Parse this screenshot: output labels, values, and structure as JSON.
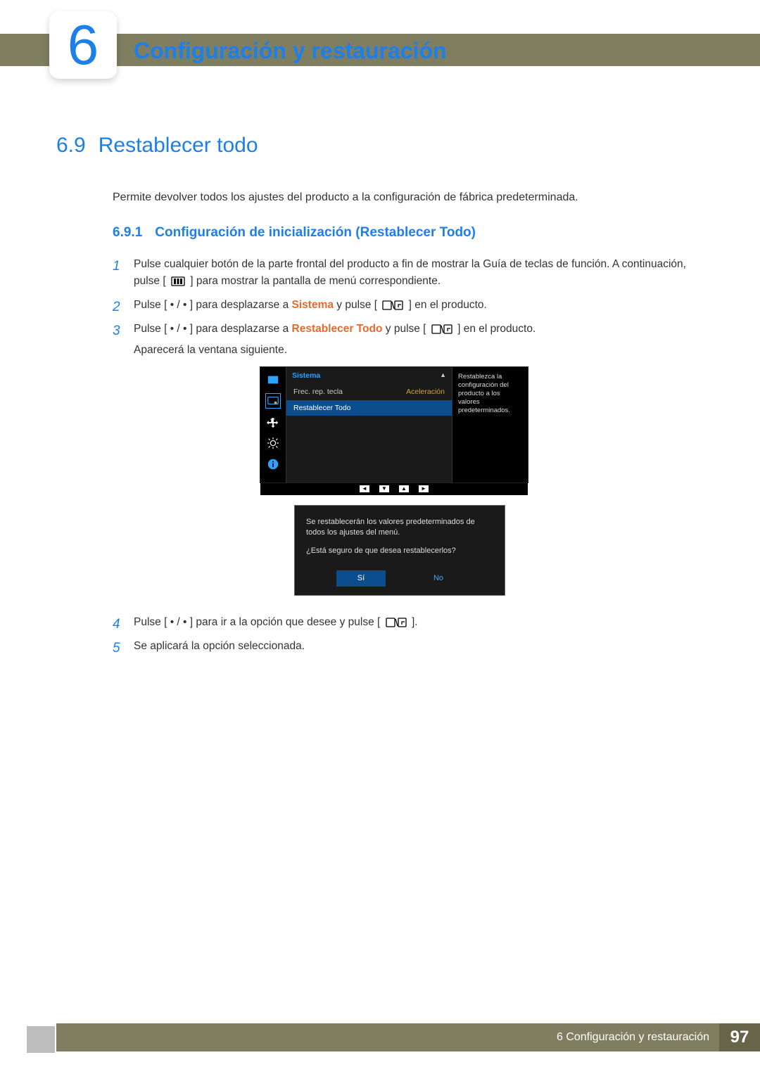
{
  "chapter": {
    "num": "6",
    "title": "Configuración y restauración"
  },
  "section": {
    "num": "6.9",
    "title": "Restablecer todo"
  },
  "intro": "Permite devolver todos los ajustes del producto a la configuración de fábrica predeterminada.",
  "sub": {
    "num": "6.9.1",
    "title": "Configuración de inicialización (Restablecer Todo)"
  },
  "steps": {
    "s1a": "Pulse cualquier botón de la parte frontal del producto a fin de mostrar la Guía de teclas de función. A continuación, pulse [",
    "s1b": "] para mostrar la pantalla de menú correspondiente.",
    "s2a": "Pulse [ • / • ] para desplazarse a ",
    "s2hl": "Sistema",
    "s2b": " y pulse [",
    "s2c": "] en el producto.",
    "s3a": "Pulse [ • / • ] para desplazarse a ",
    "s3hl": "Restablecer Todo",
    "s3b": " y pulse [",
    "s3c": "] en el producto.",
    "s3after": "Aparecerá la ventana siguiente.",
    "s4a": "Pulse [ • / • ] para ir a la opción que desee y pulse [",
    "s4b": "].",
    "s5": "Se aplicará la opción seleccionada."
  },
  "osd": {
    "title": "Sistema",
    "help": "Restablezca la configuración del producto a los valores predeterminados.",
    "row1": {
      "label": "Frec. rep. tecla",
      "value": "Aceleración"
    },
    "row2": {
      "label": "Restablecer Todo"
    },
    "nav": {
      "l": "◄",
      "d": "▼",
      "u": "▲",
      "r": "►"
    }
  },
  "dialog": {
    "line1": "Se restablecerán los valores predeterminados de todos los ajustes del menú.",
    "line2": "¿Está seguro de que desea restablecerlos?",
    "yes": "Sí",
    "no": "No"
  },
  "footer": {
    "label": "6 Configuración y restauración",
    "page": "97"
  }
}
